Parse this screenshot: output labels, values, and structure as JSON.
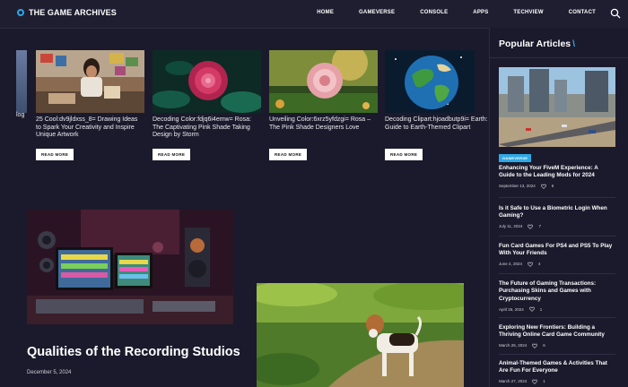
{
  "header": {
    "logo_text": "THE GAME ARCHIVES",
    "nav": [
      "HOME",
      "GAMEVERSE",
      "CONSOLE",
      "APPS",
      "TECHVIEW",
      "CONTACT"
    ],
    "search_icon": "search-icon"
  },
  "slider": {
    "partial_label": "log",
    "cards": [
      {
        "title": "25 Cool:dv9jldxss_8= Drawing Ideas to Spark Your Creativity and Inspire Unique Artwork",
        "button": "READ MORE"
      },
      {
        "title": "Decoding Color:fdjq6i4emw= Rosa: The Captivating Pink Shade Taking Design by Storm",
        "button": "READ MORE"
      },
      {
        "title": "Unveiling Color:6xrz5yfdzgi= Rosa – The Pink Shade Designers Love",
        "button": "READ MORE"
      },
      {
        "title": "Decoding Clipart:hjoadbutp9i= Earth: A Guide to Earth-Themed Clipart",
        "button": "READ MORE"
      }
    ]
  },
  "main": {
    "feature_title": "Qualities of the Recording Studios",
    "feature_date": "December 5, 2024"
  },
  "sidebar": {
    "heading": "Popular Articles",
    "heading_slash": "\\",
    "badge": "GAMEVERSE",
    "posts": [
      {
        "title": "Enhancing Your FiveM Experience: A Guide to the Leading Mods for 2024",
        "date": "September 13, 2024",
        "count": "6"
      },
      {
        "title": "Is it Safe to Use a Biometric Login When Gaming?",
        "date": "July 11, 2024",
        "count": "7"
      },
      {
        "title": "Fun Card Games For PS4 and PS5 To Play With Your Friends",
        "date": "June 4, 2024",
        "count": "4"
      },
      {
        "title": "The Future of Gaming Transactions: Purchasing Skins and Games with Cryptocurrency",
        "date": "April 26, 2024",
        "count": "1"
      },
      {
        "title": "Exploring New Frontiers: Building a Thriving Online Card Game Community",
        "date": "March 26, 2024",
        "count": "6"
      },
      {
        "title": "Animal-Themed Games & Activities That Are Fun For Everyone",
        "date": "March 27, 2024",
        "count": "1"
      }
    ]
  }
}
